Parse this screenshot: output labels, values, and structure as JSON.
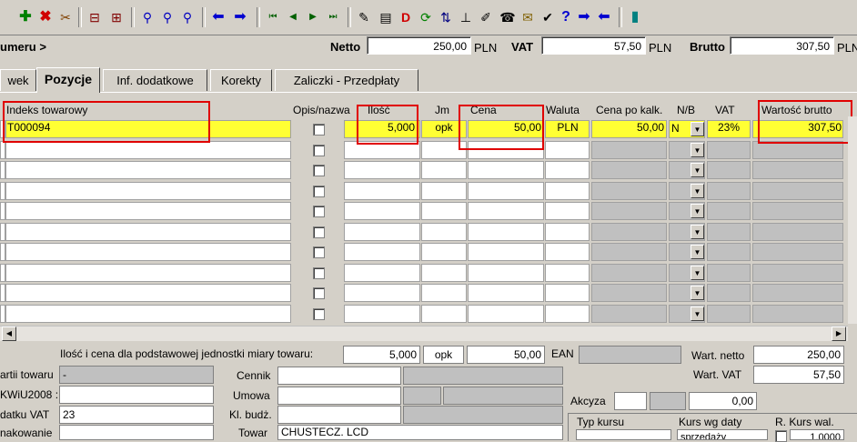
{
  "toolbar": {
    "icons": [
      "add-icon",
      "delete-icon",
      "tools-icon",
      "split-icon",
      "merge-icon",
      "find-icon",
      "find-next-icon",
      "find-replace-icon",
      "arrow-left-icon",
      "arrow-right-icon",
      "first-icon",
      "prev-icon",
      "next-icon",
      "last-icon",
      "edit-icon",
      "document-icon",
      "refresh-icon",
      "sort-icon",
      "tree-icon",
      "pen-icon",
      "phone-icon",
      "mail-icon",
      "check-icon",
      "help-icon",
      "forward-icon",
      "back-icon",
      "exit-door-icon"
    ]
  },
  "header": {
    "numer_label": "umeru >",
    "netto_label": "Netto",
    "netto_value": "250,00",
    "netto_cur": "PLN",
    "vat_label": "VAT",
    "vat_value": "57,50",
    "vat_cur": "PLN",
    "brutto_label": "Brutto",
    "brutto_value": "307,50",
    "brutto_cur": "PLN"
  },
  "tabs": [
    {
      "label": "wek"
    },
    {
      "label": "Pozycje"
    },
    {
      "label": "Inf. dodatkowe"
    },
    {
      "label": "Korekty"
    },
    {
      "label": "Zaliczki - Przedpłaty"
    }
  ],
  "grid": {
    "columns": [
      "Indeks towarowy",
      "Opis/nazwa",
      "Ilość",
      "Jm",
      "Cena",
      "Waluta",
      "Cena po kalk.",
      "N/B",
      "VAT",
      "Wartość brutto"
    ],
    "row1": {
      "indeks": "T000094",
      "ilosc": "5,000",
      "jm": "opk",
      "cena": "50,00",
      "waluta": "PLN",
      "cena_po": "50,00",
      "nb": "N",
      "vat": "23%",
      "wartosc": "307,50"
    }
  },
  "bottom": {
    "unit_note": "Ilość i cena dla podstawowej jednostki miary towaru:",
    "unit_qty": "5,000",
    "unit_jm": "opk",
    "unit_price": "50,00",
    "ean_label": "EAN",
    "wart_netto_label": "Wart. netto",
    "wart_netto": "250,00",
    "wart_vat_label": "Wart. VAT",
    "wart_vat": "57,50",
    "partii_label": "artii towaru",
    "partii_value": "-",
    "kwiu_label": "KWiU2008 :",
    "stawka_label": "datku VAT",
    "stawka_value": "23",
    "opak_label": "nakowanie",
    "cennik_label": "Cennik",
    "umowa_label": "Umowa",
    "klbud_label": "Kl. budż.",
    "towar_label": "Towar",
    "towar_value": "CHUSTECZ. LCD",
    "akcyza_label": "Akcyza",
    "akcyza_value": "0,00",
    "typ_kursu_label": "Typ kursu",
    "kurs_wg_label": "Kurs wg daty",
    "kurs_wg_value": "sprzedaży",
    "rkurs_label": "R. Kurs wal.",
    "rkurs_value": "1,0000"
  }
}
